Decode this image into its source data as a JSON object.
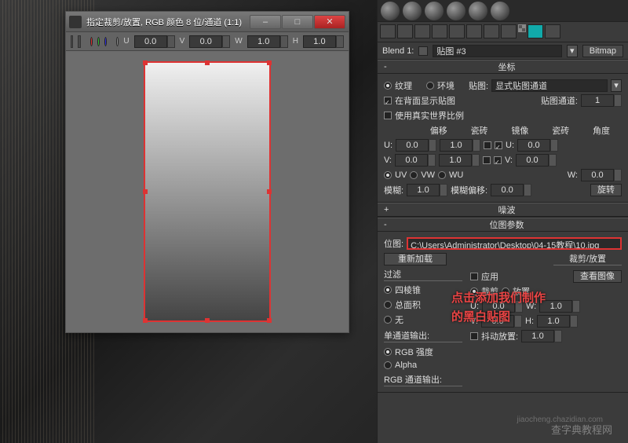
{
  "crop_dialog": {
    "title": "指定裁剪/放置, RGB 颜色 8 位/通道 (1:1)",
    "toolbar": {
      "u": "U",
      "u_val": "0.0",
      "v": "V",
      "v_val": "0.0",
      "w": "W",
      "w_val": "1.0",
      "h": "H",
      "h_val": "1.0"
    }
  },
  "blend": {
    "label": "Blend 1:",
    "map_name": "贴图 #3",
    "type": "Bitmap"
  },
  "rollups": {
    "coords": {
      "title": "坐标",
      "texture": "纹理",
      "environ": "环境",
      "mapping_lbl": "贴图:",
      "mapping_val": "显式贴图通道",
      "show_back": "在背面显示贴图",
      "channel_lbl": "贴图通道:",
      "channel_val": "1",
      "realworld": "使用真实世界比例",
      "offset": "偏移",
      "tiling": "瓷砖",
      "mirror": "镜像",
      "tile": "瓷砖",
      "angle": "角度",
      "u": "U:",
      "v": "V:",
      "w": "W:",
      "u_off": "0.0",
      "u_tile": "1.0",
      "u_ang": "0.0",
      "v_off": "0.0",
      "v_tile": "1.0",
      "v_ang": "0.0",
      "w_ang": "0.0",
      "uv": "UV",
      "vw": "VW",
      "wu": "WU",
      "blur_lbl": "模糊:",
      "blur_val": "1.0",
      "blur_off_lbl": "模糊偏移:",
      "blur_off_val": "0.0",
      "rotate": "旋转"
    },
    "noise": {
      "title": "噪波"
    },
    "bitmap": {
      "title": "位图参数",
      "path_lbl": "位图:",
      "path_val": "C:\\Users\\Administrator\\Desktop\\04-15教程\\10.jpg",
      "reload": "重新加载",
      "filter_hdr": "过滤",
      "pyramidal": "四棱锥",
      "summed": "总面积",
      "none": "无",
      "crop_hdr": "裁剪/放置",
      "apply": "应用",
      "view": "查看图像",
      "crop": "裁剪",
      "place": "放置",
      "u": "U:",
      "u_val": "0.0",
      "v": "V:",
      "v_val": "0.0",
      "w": "W:",
      "w_val": "1.0",
      "h": "H:",
      "h_val": "1.0",
      "jitter": "抖动放置:",
      "jitter_val": "1.0",
      "mono_hdr": "单通道输出:",
      "rgb_intensity": "RGB 强度",
      "alpha": "Alpha",
      "rgb_out_hdr": "RGB 通道输出:"
    }
  },
  "annotation": {
    "line1": "点击添加我们制作",
    "line2": "的黑白贴图"
  },
  "watermark": {
    "main": "查字典教程网",
    "sub": "jiaocheng.chazidian.com"
  }
}
